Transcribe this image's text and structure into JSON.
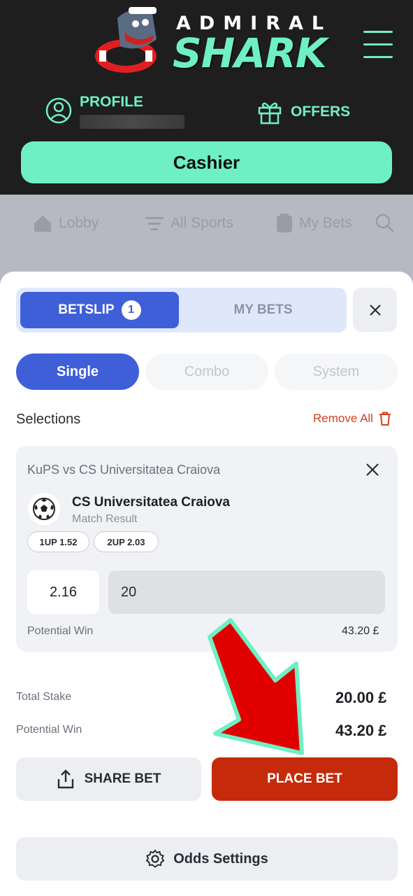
{
  "header": {
    "logo_top": "ADMIRAL",
    "logo_main": "SHARK",
    "profile_label": "PROFILE",
    "offers_label": "OFFERS",
    "cashier_label": "Cashier"
  },
  "nav": {
    "items": [
      {
        "label": "Lobby",
        "icon": "home-icon"
      },
      {
        "label": "All Sports",
        "icon": "filter-icon"
      },
      {
        "label": "My Bets",
        "icon": "clipboard-icon"
      }
    ]
  },
  "betslip": {
    "tab_betslip": "BETSLIP",
    "badge": "1",
    "tab_mybets": "MY BETS",
    "modes": [
      "Single",
      "Combo",
      "System"
    ],
    "selections_title": "Selections",
    "remove_all": "Remove All",
    "card": {
      "match": "KuPS vs CS Universitatea Craiova",
      "selection": "CS Universitatea Craiova",
      "market": "Match Result",
      "chips": [
        "1UP 1.52",
        "2UP 2.03"
      ],
      "odds": "2.16",
      "stake": "20",
      "potential_win_label": "Potential Win",
      "potential_win": "43.20 £"
    },
    "totals": {
      "stake_label": "Total Stake",
      "stake": "20.00 £",
      "win_label": "Potential Win",
      "win": "43.20 £"
    },
    "share_label": "SHARE BET",
    "place_label": "PLACE BET",
    "odds_settings_label": "Odds Settings"
  },
  "colors": {
    "brand": "#6ff0c4",
    "primary": "#3f5fd9",
    "place_bet": "#c52b0a",
    "arrow": "#e00000"
  }
}
